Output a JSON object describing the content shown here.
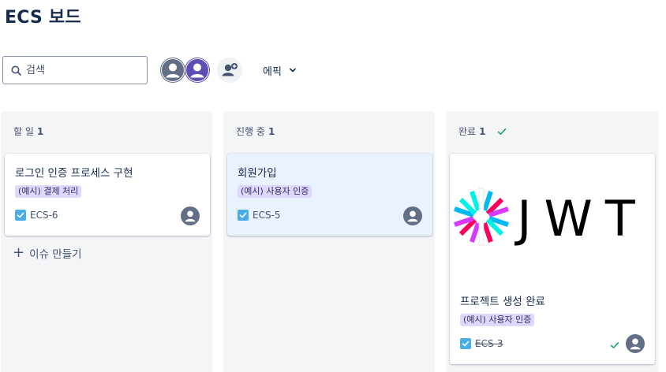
{
  "board": {
    "title": "ECS 보드"
  },
  "toolbar": {
    "search_placeholder": "검색",
    "epic_label": "에픽"
  },
  "columns": [
    {
      "name": "할 일",
      "count": "1",
      "cards": [
        {
          "title": "로그인 인증 프로세스 구현",
          "epic": "(예시) 결제 처리",
          "key": "ECS-6"
        }
      ],
      "create_label": "이슈 만들기"
    },
    {
      "name": "진행 중",
      "count": "1",
      "cards": [
        {
          "title": "회원가입",
          "epic": "(예시) 사용자 인증",
          "key": "ECS-5"
        }
      ]
    },
    {
      "name": "완료",
      "count": "1",
      "done": true,
      "cards": [
        {
          "title": "프로젝트 생성 완료",
          "epic": "(예시) 사용자 인증",
          "key": "ECS-3",
          "image_text": "JWT"
        }
      ]
    }
  ],
  "colors": {
    "accent": "#0c66e4",
    "lozenge_bg": "#dfd8fd",
    "done_check": "#22a06b",
    "avatar_gray": "#626f86",
    "avatar_purple": "#5e4db2"
  },
  "icons": [
    "search-icon",
    "person-icon",
    "add-person-icon",
    "chevron-down-icon",
    "checkbox-icon",
    "check-icon",
    "plus-icon"
  ]
}
